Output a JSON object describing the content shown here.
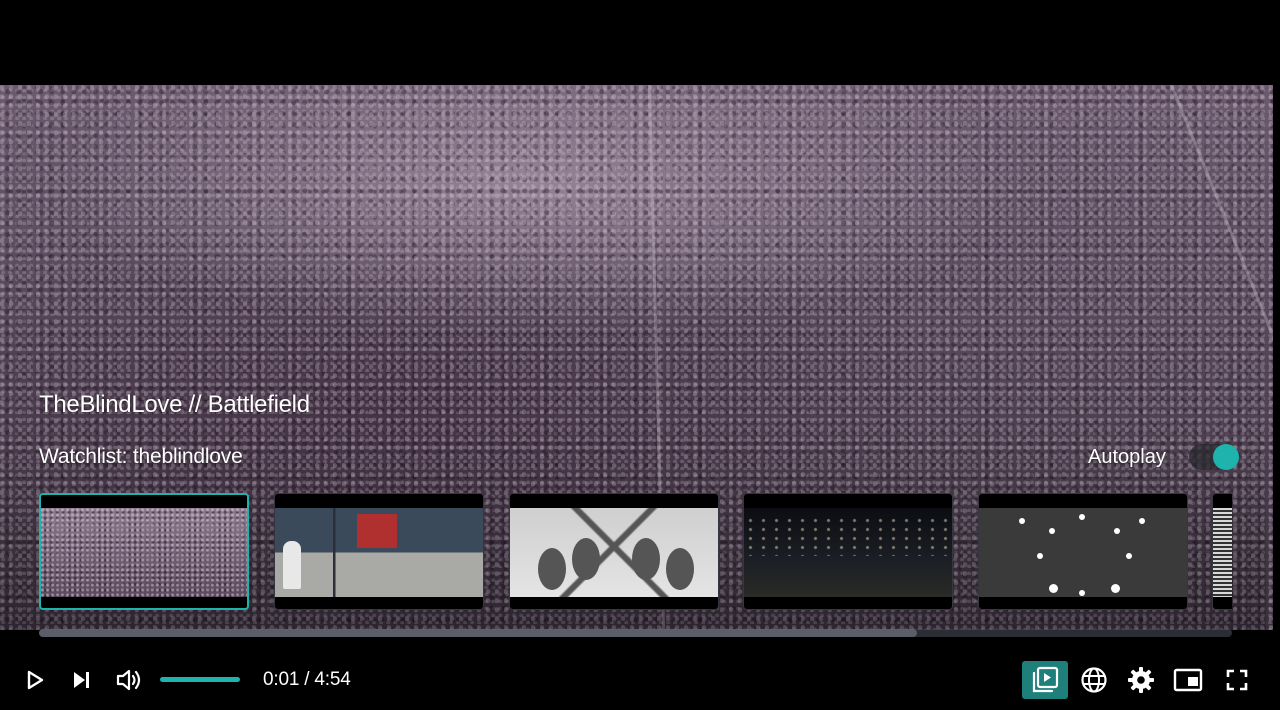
{
  "video": {
    "title": "TheBlindLove // Battlefield",
    "watchlist_label": "Watchlist: theblindlove",
    "autoplay_label": "Autoplay",
    "autoplay_on": true
  },
  "thumbnails": [
    {
      "label": "battlefield-crowd",
      "active": true
    },
    {
      "label": "storefront-street",
      "active": false
    },
    {
      "label": "mirrored-leaves",
      "active": false
    },
    {
      "label": "night-city-street",
      "active": false
    },
    {
      "label": "dark-lights-pattern",
      "active": false
    },
    {
      "label": "striped-partial",
      "active": false
    }
  ],
  "playlist_scroll": {
    "visible_fraction": 0.736
  },
  "controls": {
    "time": "0:01 / 4:54",
    "volume_level": 1.0,
    "icons": [
      "play-icon",
      "skip-next-icon",
      "volume-icon",
      "playlist-icon",
      "globe-icon",
      "settings-gear-icon",
      "picture-in-picture-icon",
      "fullscreen-icon"
    ]
  },
  "colors": {
    "accent": "#1fb3ad",
    "active_button_bg": "#1f7f7b",
    "background": "#000000"
  }
}
